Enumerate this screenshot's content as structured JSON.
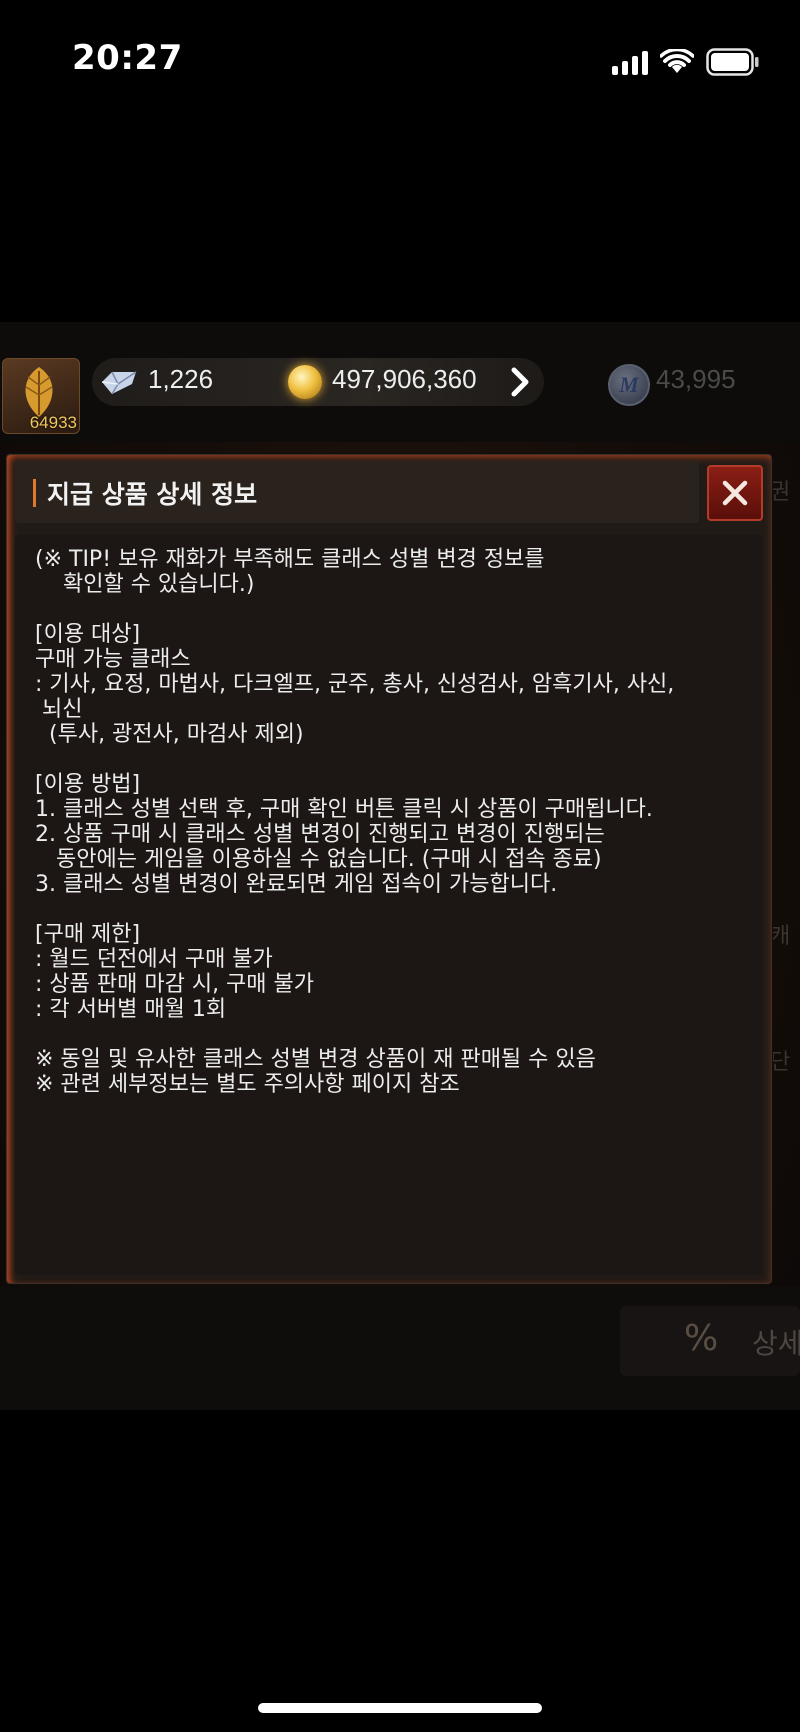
{
  "status_bar": {
    "time": "20:27"
  },
  "player": {
    "level": "64933"
  },
  "currencies": {
    "diamond": "1,226",
    "gold": "497,906,360",
    "mileage": "43,995"
  },
  "background_fringe": {
    "right_top": "권",
    "right_middle": "캐",
    "right_lower": "단",
    "detail_button": "상세"
  },
  "bottom": {
    "percent_icon": "%"
  },
  "modal": {
    "title": "지급 상품 상세 정보",
    "close_label": "×",
    "body": "(※ TIP! 보유 재화가 부족해도 클래스 성별 변경 정보를\n    확인할 수 있습니다.)\n\n[이용 대상]\n구매 가능 클래스\n: 기사, 요정, 마법사, 다크엘프, 군주, 총사, 신성검사, 암흑기사, 사신,\n 뇌신\n  (투사, 광전사, 마검사 제외)\n\n[이용 방법]\n1. 클래스 성별 선택 후, 구매 확인 버튼 클릭 시 상품이 구매됩니다.\n2. 상품 구매 시 클래스 성별 변경이 진행되고 변경이 진행되는\n   동안에는 게임을 이용하실 수 없습니다. (구매 시 접속 종료)\n3. 클래스 성별 변경이 완료되면 게임 접속이 가능합니다.\n\n[구매 제한]\n: 월드 던전에서 구매 불가\n: 상품 판매 마감 시, 구매 불가\n: 각 서버별 매월 1회\n\n※ 동일 및 유사한 클래스 성별 변경 상품이 재 판매될 수 있음\n※ 관련 세부정보는 별도 주의사항 페이지 참조"
  },
  "colors": {
    "accent": "#e07a2a",
    "close_button": "#8a1e14",
    "glow": "#c84a1e"
  }
}
